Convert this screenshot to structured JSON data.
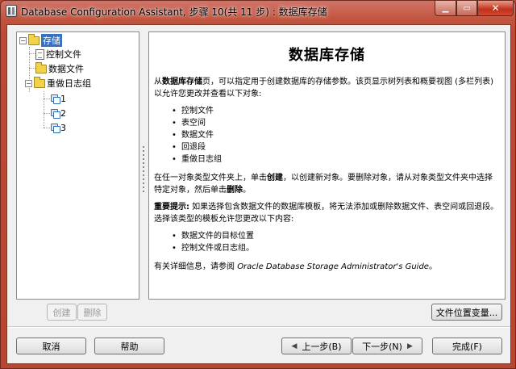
{
  "window": {
    "title": "Database Configuration Assistant, 步骤 10(共 11 步) : 数据库存储",
    "minimize": "▁",
    "maximize": "▭",
    "close": "✕"
  },
  "tree": {
    "root_label": "存储",
    "items": [
      {
        "label": "控制文件",
        "icon": "control-file-icon"
      },
      {
        "label": "数据文件",
        "icon": "folder-icon"
      },
      {
        "label": "重做日志组",
        "icon": "folder-icon"
      }
    ],
    "redo_groups": [
      "1",
      "2",
      "3"
    ],
    "expander_open": "−"
  },
  "content": {
    "title": "数据库存储",
    "intro_prefix": "从",
    "intro_bold": "数据库存储",
    "intro_suffix": "页，可以指定用于创建数据库的存储参数。该页显示树列表和概要视图 (多栏列表) 以允许您更改并查看以下对象:",
    "objects": [
      "控制文件",
      "表空间",
      "数据文件",
      "回退段",
      "重做日志组"
    ],
    "create_p1": "在任一对象类型文件夹上，单击",
    "create_b1": "创建",
    "create_p2": "，以创建新对象。要删除对象，请从对象类型文件夹中选择特定对象，然后单击",
    "create_b2": "删除",
    "create_p3": "。",
    "important_label": "重要提示:",
    "important_text": " 如果选择包含数据文件的数据库模板，将无法添加或删除数据文件、表空间或回退段。选择该类型的模板允许您更改以下内容:",
    "changes": [
      "数据文件的目标位置",
      "控制文件或日志组。"
    ],
    "more_prefix": "有关详细信息，请参阅 ",
    "more_ref": "Oracle Database Storage Administrator's Guide",
    "more_suffix": "。"
  },
  "buttons": {
    "create": "创建",
    "delete": "删除",
    "file_locations": "文件位置变量...",
    "cancel": "取消",
    "help": "帮助",
    "back": "上一步(B)",
    "next": "下一步(N)",
    "finish": "完成(F)"
  }
}
